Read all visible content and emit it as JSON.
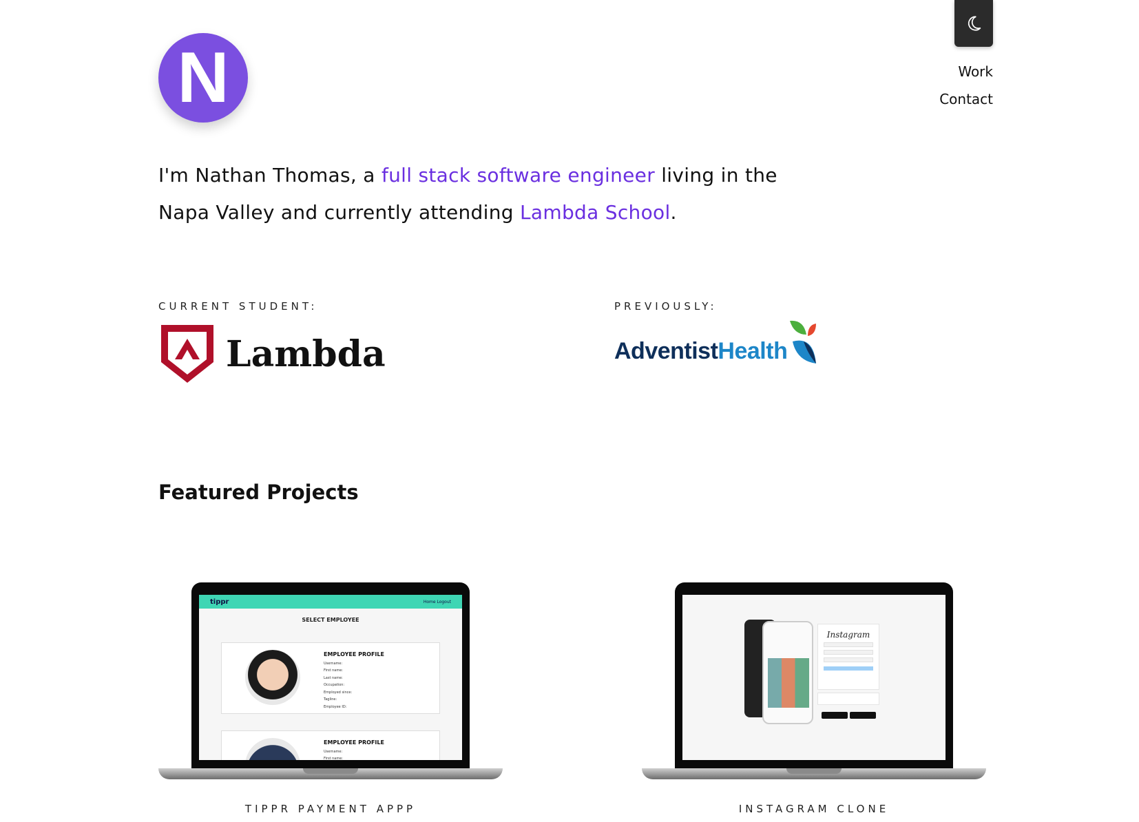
{
  "header": {
    "logo_letter": "N",
    "nav": [
      {
        "label": "Work"
      },
      {
        "label": "Contact"
      }
    ],
    "theme_toggle_icon": "moon-icon"
  },
  "intro": {
    "part1": "I'm Nathan Thomas, a ",
    "link1": "full stack software engineer",
    "part2": " living in the Napa Valley and currently attending ",
    "link2": "Lambda School",
    "part3": "."
  },
  "education": {
    "current_label": "CURRENT STUDENT:",
    "current_logo_text": "Lambda",
    "previous_label": "PREVIOUSLY:",
    "previous_logo_text_1": "Adventist",
    "previous_logo_text_2": "Health"
  },
  "projects": {
    "title": "Featured Projects",
    "items": [
      {
        "caption": "TIPPR PAYMENT APPP",
        "screen": {
          "brand": "tippr",
          "nav": "Home   Logout",
          "heading": "SELECT EMPLOYEE",
          "card_heading": "EMPLOYEE PROFILE",
          "fields": [
            "Username:",
            "First name:",
            "Last name:",
            "Occupation:",
            "Employed since:",
            "Tagline:",
            "Employee ID:"
          ]
        }
      },
      {
        "caption": "INSTAGRAM CLONE",
        "screen": {
          "brand": "Instagram"
        }
      }
    ]
  },
  "colors": {
    "accent": "#6a2fe0",
    "logo_bg": "#7b4fe0",
    "toggle_bg": "#2b2b2b",
    "lambda_red": "#b0102a",
    "adventist_navy": "#0e2f5a",
    "adventist_blue": "#1d86c8"
  }
}
